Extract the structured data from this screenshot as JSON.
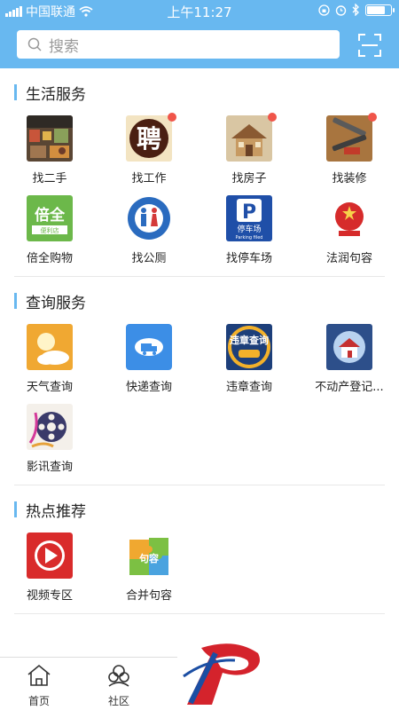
{
  "status": {
    "carrier": "中国联通",
    "time": "上午11:27"
  },
  "search": {
    "placeholder": "搜索"
  },
  "sections": {
    "life": {
      "title": "生活服务",
      "items": [
        {
          "label": "找二手"
        },
        {
          "label": "找工作"
        },
        {
          "label": "找房子"
        },
        {
          "label": "找装修"
        },
        {
          "label": "倍全购物"
        },
        {
          "label": "找公厕"
        },
        {
          "label": "找停车场"
        },
        {
          "label": "法润句容"
        }
      ]
    },
    "query": {
      "title": "查询服务",
      "items": [
        {
          "label": "天气查询"
        },
        {
          "label": "快递查询"
        },
        {
          "label": "违章查询"
        },
        {
          "label": "不动产登记..."
        },
        {
          "label": "影讯查询"
        }
      ]
    },
    "hot": {
      "title": "热点推荐",
      "items": [
        {
          "label": "视频专区"
        },
        {
          "label": "合并句容"
        }
      ]
    }
  },
  "icon_text": {
    "pin": "聘",
    "beiquan": "倍全",
    "beiquan_sub": "便利店",
    "parking_letter": "P",
    "parking_cn": "停车场",
    "parking_en": "Parking filed",
    "violation": "违章查询",
    "merge": "句容"
  },
  "tabs": [
    {
      "label": "首页"
    },
    {
      "label": "社区"
    }
  ],
  "colors": {
    "header": "#68b8f0",
    "badge": "#f0554a",
    "accent_bar": "#68b8f0"
  }
}
